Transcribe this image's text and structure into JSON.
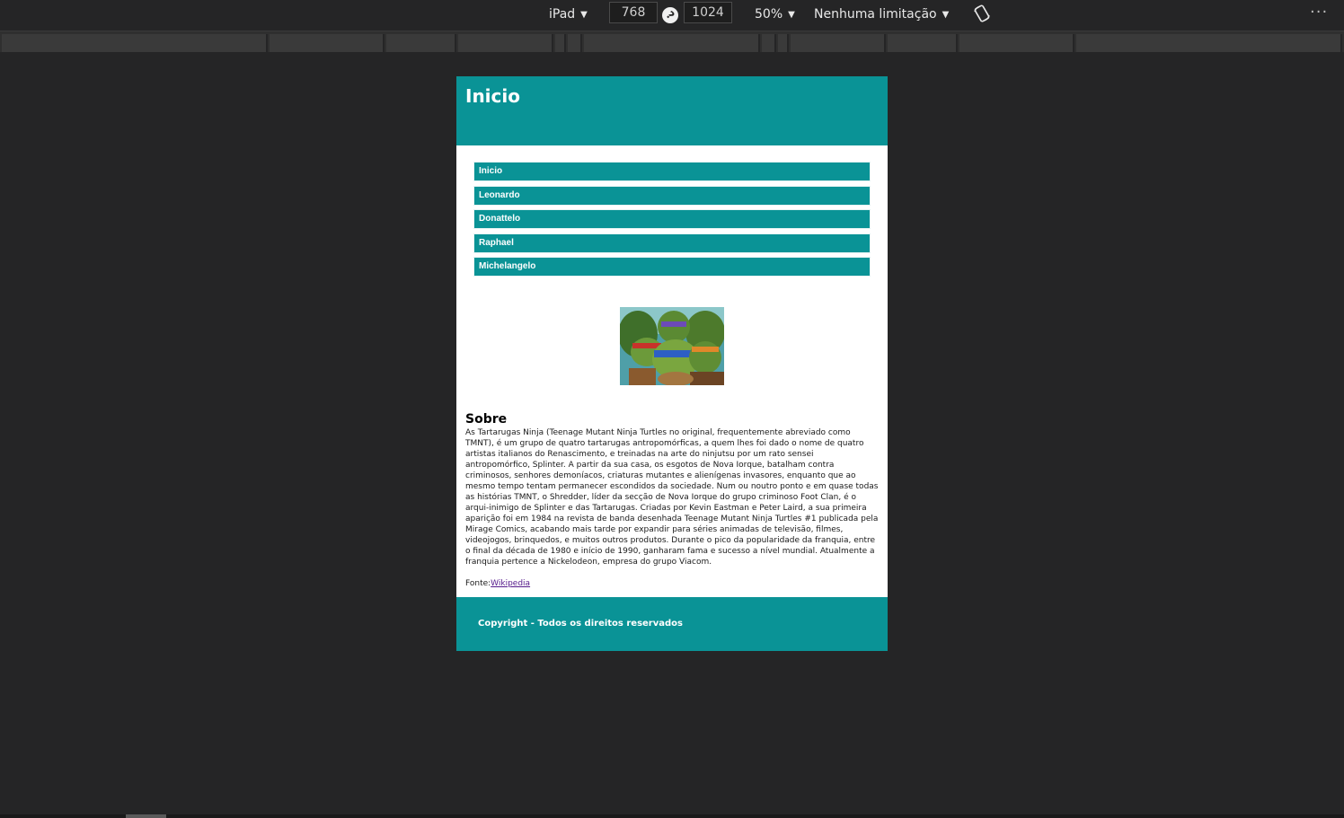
{
  "toolbar": {
    "device": "iPad",
    "width": "768",
    "height": "1024",
    "zoom": "50%",
    "throttling": "Nenhuma limitação",
    "more": "···"
  },
  "site": {
    "header_title": "Inicio",
    "nav": [
      {
        "label": "Inicio"
      },
      {
        "label": "Leonardo"
      },
      {
        "label": "Donattelo"
      },
      {
        "label": "Raphael"
      },
      {
        "label": "Michelangelo"
      }
    ],
    "about": {
      "title": "Sobre",
      "text": "As Tartarugas Ninja (Teenage Mutant Ninja Turtles no original, frequentemente abreviado como TMNT), é um grupo de quatro tartarugas antropomórficas, a quem lhes foi dado o nome de quatro artistas italianos do Renascimento, e treinadas na arte do ninjutsu por um rato sensei antropomórfico, Splinter. A partir da sua casa, os esgotos de Nova Iorque, batalham contra criminosos, senhores demoníacos, criaturas mutantes e alienígenas invasores, enquanto que ao mesmo tempo tentam permanecer escondidos da sociedade. Num ou noutro ponto e em quase todas as histórias TMNT, o Shredder, líder da secção de Nova Iorque do grupo criminoso Foot Clan, é o arqui-inimigo de Splinter e das Tartarugas. Criadas por Kevin Eastman e Peter Laird, a sua primeira aparição foi em 1984 na revista de banda desenhada Teenage Mutant Ninja Turtles #1 publicada pela Mirage Comics, acabando mais tarde por expandir para séries animadas de televisão, filmes, videojogos, brinquedos, e muitos outros produtos. Durante o pico da popularidade da franquia, entre o final da década de 1980 e início de 1990, ganharam fama e sucesso a nível mundial. Atualmente a franquia pertence a Nickelodeon, empresa do grupo Viacom.",
      "source_prefix": "Fonte:",
      "source_link": "Wikipedia"
    },
    "footer": "Copyright - Todos os direitos reservados"
  },
  "colors": {
    "brand": "#0a9396",
    "devtools_bg": "#252526"
  }
}
